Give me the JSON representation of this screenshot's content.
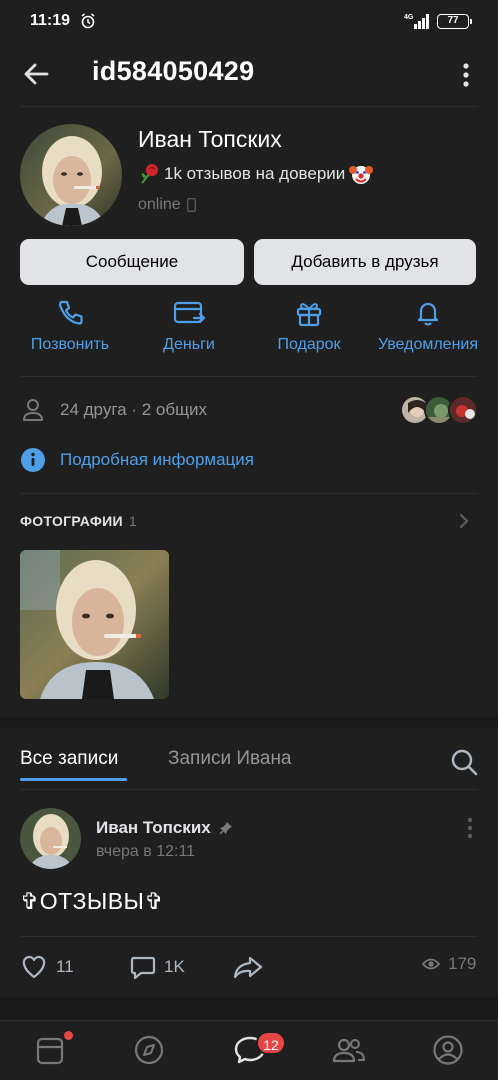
{
  "status_bar": {
    "time": "11:19",
    "network": "4G",
    "battery": "77"
  },
  "header": {
    "title": "id584050429"
  },
  "profile": {
    "name": "Иван Топских",
    "status_text": "1k отзывов на доверии",
    "online": "online"
  },
  "buttons": {
    "message": "Сообщение",
    "add_friend": "Добавить в друзья"
  },
  "actions": [
    {
      "label": "Позвонить",
      "icon": "phone-icon"
    },
    {
      "label": "Деньги",
      "icon": "money-icon"
    },
    {
      "label": "Подарок",
      "icon": "gift-icon"
    },
    {
      "label": "Уведомления",
      "icon": "bell-icon"
    }
  ],
  "friends": {
    "text": "24 друга · 2 общих"
  },
  "details": {
    "label": "Подробная информация"
  },
  "photos": {
    "title": "ФОТОГРАФИИ",
    "count": "1"
  },
  "wall": {
    "tabs": [
      "Все записи",
      "Записи Ивана"
    ],
    "post": {
      "author": "Иван Топских",
      "time": "вчера в 12:11",
      "text": "✞ОТЗЫВЫ✞",
      "likes": "11",
      "comments": "1K",
      "views": "179"
    }
  },
  "nav": {
    "messages_badge": "12"
  },
  "colors": {
    "accent": "#4f9fe8",
    "background": "#19191a",
    "card": "#1f1f20",
    "badge": "#e64646"
  }
}
